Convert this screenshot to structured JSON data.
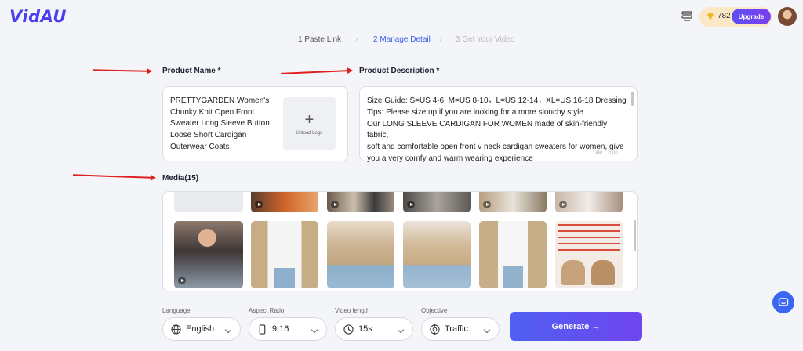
{
  "app": {
    "logo": "VidAU"
  },
  "header": {
    "credits": "782",
    "upgrade_label": "Upgrade"
  },
  "steps": [
    {
      "label": "1 Paste Link"
    },
    {
      "label": "2 Manage Detail"
    },
    {
      "label": "3 Get Your Video"
    }
  ],
  "form": {
    "product_name_label": "Product Name *",
    "product_name_value": "PRETTYGARDEN Women's\nChunky Knit Open Front\nSweater Long Sleeve Button\nLoose Short Cardigan\nOuterwear Coats",
    "upload_logo_label": "Upload Logo",
    "description_label": "Product Description *",
    "description_value": "Size Guide: S=US 4-6, M=US 8-10，L=US 12-14，XL=US 16-18 Dressing\nTips: Please size up if you are looking for a more slouchy style\nOur LONG SLEEVE CARDIGAN FOR WOMEN made of skin-friendly fabric,\nsoft and comfortable open front v neck cardigan sweaters for women, give\nyou a very comfy and warm wearing experience",
    "description_counter": "1461 / 2000",
    "media_label": "Media(15)"
  },
  "controls": {
    "language_label": "Language",
    "language_value": "English",
    "aspect_label": "Aspect Ratio",
    "aspect_value": "9:16",
    "length_label": "Video length",
    "length_value": "15s",
    "objective_label": "Objective",
    "objective_value": "Traffic",
    "generate_label": "Generate →"
  },
  "colors": {
    "accent": "#3b5bf2",
    "arrow": "#e02020",
    "upgrade": "#5b4ff6"
  }
}
